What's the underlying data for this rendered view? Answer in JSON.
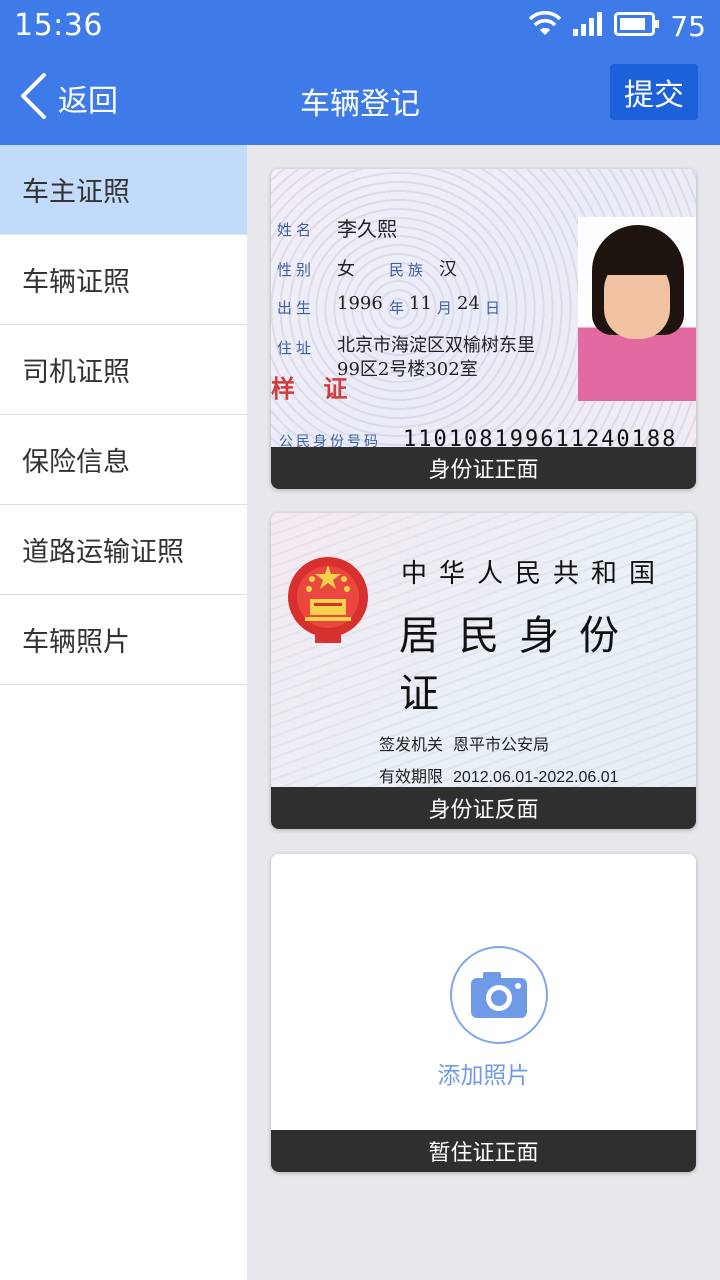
{
  "status_bar": {
    "time": "15:36",
    "battery": "75",
    "icons": [
      "wifi-icon",
      "signal-icon",
      "battery-icon"
    ]
  },
  "header": {
    "back_label": "返回",
    "title": "车辆登记",
    "submit_label": "提交",
    "accent_color": "#3f7be8"
  },
  "sidebar": {
    "items": [
      {
        "label": "车主证照",
        "active": true
      },
      {
        "label": "车辆证照",
        "active": false
      },
      {
        "label": "司机证照",
        "active": false
      },
      {
        "label": "保险信息",
        "active": false
      },
      {
        "label": "道路运输证照",
        "active": false
      },
      {
        "label": "车辆照片",
        "active": false
      }
    ]
  },
  "cards": {
    "id_front": {
      "caption": "身份证正面",
      "labels": {
        "name": "姓名",
        "gender": "性别",
        "ethnicity": "民族",
        "birth": "出生",
        "year": "年",
        "month": "月",
        "day": "日",
        "address": "住址",
        "id_number": "公民身份号码"
      },
      "name": "李久熙",
      "gender": "女",
      "ethnicity": "汉",
      "birth_year": "1996",
      "birth_month": "11",
      "birth_day": "24",
      "address_line1": "北京市海淀区双榆树东里",
      "address_line2": "99区2号楼302室",
      "stamp": "样 证",
      "id_number": "110108199611240188"
    },
    "id_back": {
      "caption": "身份证反面",
      "nation": "中华人民共和国",
      "card_title": "居民身份证",
      "issuer_label": "签发机关",
      "issuer": "恩平市公安局",
      "validity_label": "有效期限",
      "validity": "2012.06.01-2022.06.01"
    },
    "temp_residence": {
      "caption": "暂住证正面",
      "add_label": "添加照片",
      "icon": "camera-icon"
    }
  }
}
